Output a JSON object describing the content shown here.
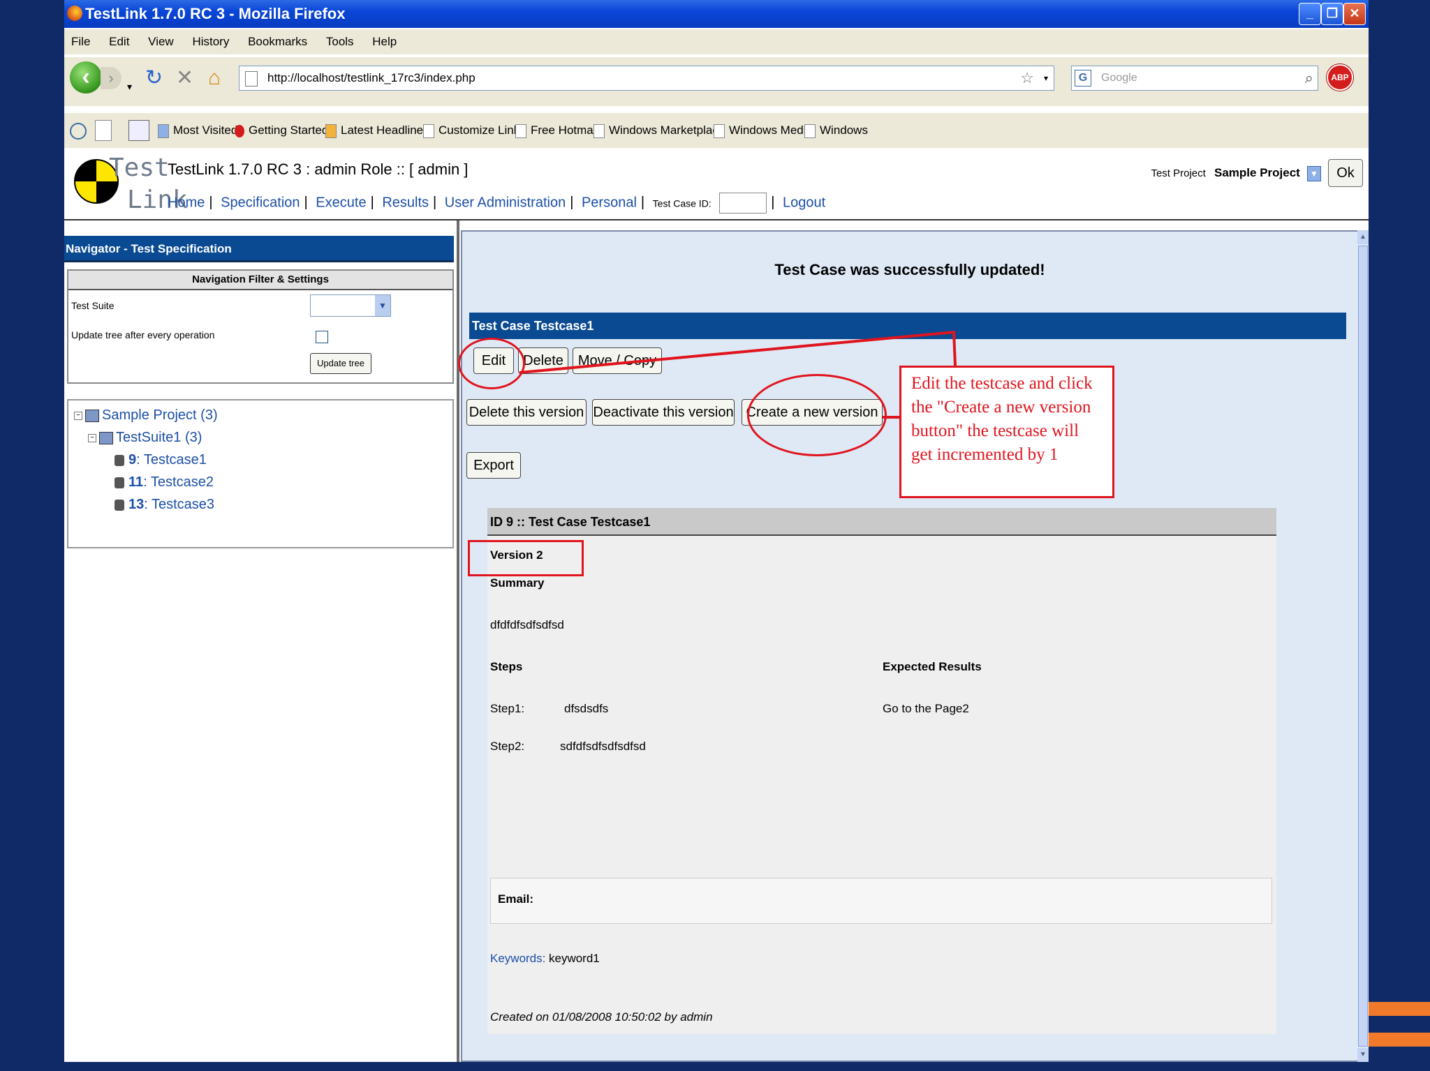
{
  "window": {
    "title": "TestLink 1.7.0 RC 3 - Mozilla Firefox"
  },
  "menu": [
    "File",
    "Edit",
    "View",
    "History",
    "Bookmarks",
    "Tools",
    "Help"
  ],
  "navbar": {
    "url": "http://localhost/testlink_17rc3/index.php",
    "search_placeholder": "Google",
    "abp_label": "ABP"
  },
  "bookmarks": [
    "Most Visited",
    "Getting Started",
    "Latest Headlines",
    "Customize Links",
    "Free Hotmail",
    "Windows Marketplace",
    "Windows Media",
    "Windows"
  ],
  "testlink": {
    "logo_top": "Test",
    "logo_bottom": "Link",
    "title": "TestLink 1.7.0 RC 3 : admin Role :: [ admin ]",
    "links": [
      "Home",
      "Specification",
      "Execute",
      "Results",
      "User Administration",
      "Personal"
    ],
    "testcase_id_label": "Test Case ID:",
    "logout": "Logout",
    "project_label": "Test Project",
    "project_value": "Sample Project",
    "ok": "Ok"
  },
  "navigator": {
    "title": "Navigator - Test Specification",
    "filter_title": "Navigation Filter & Settings",
    "test_suite_label": "Test Suite",
    "update_tree_label": "Update tree after every operation",
    "update_button": "Update tree",
    "tree": {
      "project": "Sample Project (3)",
      "suite": "TestSuite1 (3)",
      "cases": [
        {
          "id": "9",
          "name": ": Testcase1"
        },
        {
          "id": "11",
          "name": ": Testcase2"
        },
        {
          "id": "13",
          "name": ": Testcase3"
        }
      ]
    }
  },
  "main": {
    "success": "Test Case was successfully updated!",
    "header": "Test Case Testcase1",
    "buttons": {
      "edit": "Edit",
      "delete": "Delete",
      "move": "Move / Copy",
      "delete_version": "Delete this version",
      "deactivate": "Deactivate this version",
      "create_version": "Create a new version",
      "export": "Export"
    },
    "detail": {
      "title": "ID 9 :: Test Case Testcase1",
      "version": "Version 2",
      "summary_label": "Summary",
      "summary": "dfdfdfsdfsdfsd",
      "steps_label": "Steps",
      "expected_label": "Expected Results",
      "step1_label": "Step1:",
      "step1": "dfsdsdfs",
      "step1_expected": "Go to the Page2",
      "step2_label": "Step2:",
      "step2": "sdfdfsdfsdfsdfsd",
      "email_label": "Email:",
      "keywords_label": "Keywords:",
      "keywords": "keyword1",
      "created": "Created on 01/08/2008 10:50:02  by admin"
    }
  },
  "annotation": {
    "callout": "Edit the testcase and click the \"Create a new version button\" the testcase will get incremented by 1",
    "color": "#e0141e"
  }
}
